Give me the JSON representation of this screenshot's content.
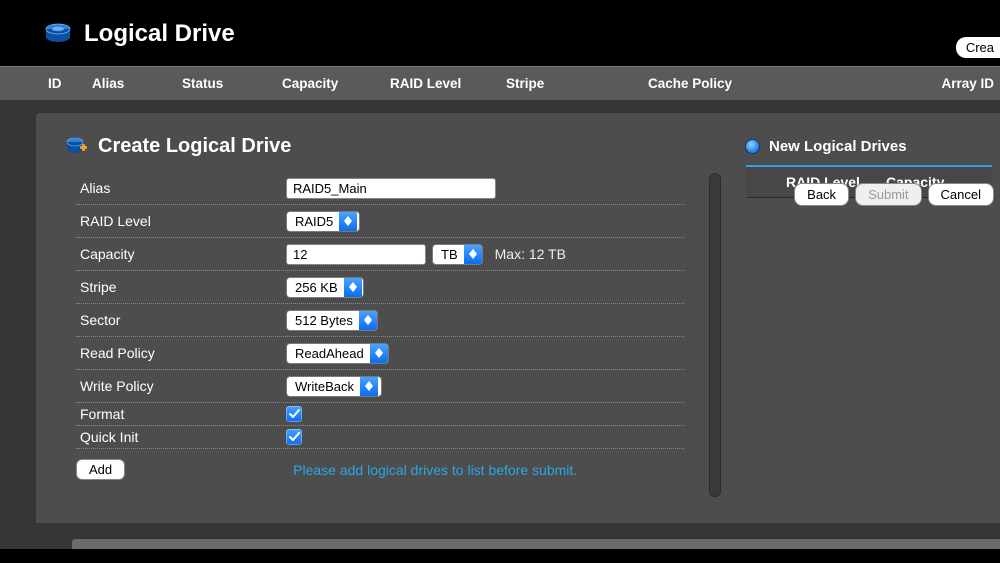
{
  "header": {
    "title": "Logical Drive",
    "create_button": "Crea"
  },
  "columns": {
    "id": "ID",
    "alias": "Alias",
    "status": "Status",
    "capacity": "Capacity",
    "raid_level": "RAID Level",
    "stripe": "Stripe",
    "cache_policy": "Cache Policy",
    "array_id": "Array ID"
  },
  "panel": {
    "title": "Create Logical Drive"
  },
  "form": {
    "alias_label": "Alias",
    "alias_value": "RAID5_Main",
    "raid_label": "RAID Level",
    "raid_value": "RAID5",
    "capacity_label": "Capacity",
    "capacity_value": "12",
    "capacity_unit": "TB",
    "capacity_max": "Max: 12 TB",
    "stripe_label": "Stripe",
    "stripe_value": "256 KB",
    "sector_label": "Sector",
    "sector_value": "512 Bytes",
    "read_label": "Read Policy",
    "read_value": "ReadAhead",
    "write_label": "Write Policy",
    "write_value": "WriteBack",
    "format_label": "Format",
    "quick_label": "Quick Init",
    "add_button": "Add",
    "hint": "Please add logical drives to list before submit."
  },
  "right": {
    "title": "New Logical Drives",
    "col_raid": "RAID Level",
    "col_capacity": "Capacity"
  },
  "buttons": {
    "back": "Back",
    "submit": "Submit",
    "cancel": "Cancel"
  }
}
